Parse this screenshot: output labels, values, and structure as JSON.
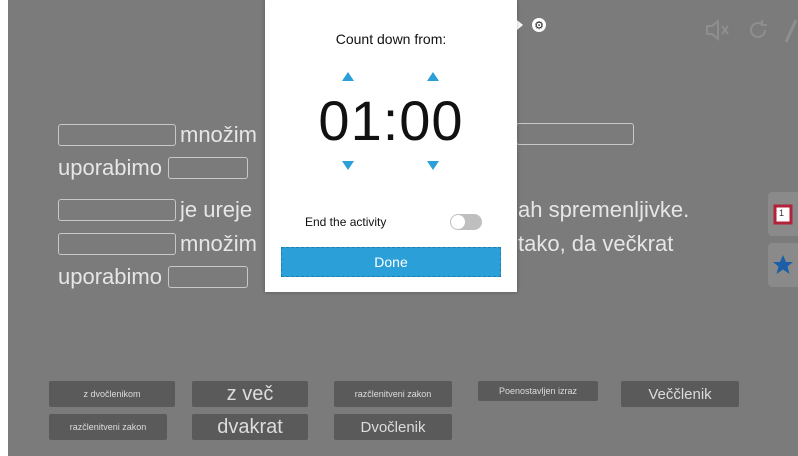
{
  "sentences": [
    {
      "text": "množim"
    },
    {
      "text": "uporabimo"
    },
    {
      "text": "je ureje",
      "tail": "ah spremenljivke."
    },
    {
      "text": "množim",
      "tail": "tako, da večkrat"
    },
    {
      "text": "uporabimo"
    }
  ],
  "chips": [
    {
      "label": "z dvočlenikom"
    },
    {
      "label": "z več"
    },
    {
      "label": "razčlenitveni zakon"
    },
    {
      "label": "Poenostavljen izraz"
    },
    {
      "label": "Veččlenik"
    },
    {
      "label": "razčlenitveni zakon"
    },
    {
      "label": "dvakrat"
    },
    {
      "label": "Dvočlenik"
    }
  ],
  "side_buttons": {
    "calendar_number": "1"
  },
  "modal": {
    "title": "Count down from:",
    "time": "01:00",
    "end_label": "End the activity",
    "toggle_on": false,
    "done_label": "Done"
  },
  "colors": {
    "accent": "#2a9fd8",
    "overlay": "#7b7b7b",
    "chip": "#5a5a5a"
  },
  "icons": [
    "gear-icon",
    "mute-icon",
    "reload-icon",
    "pen-icon",
    "calendar-icon",
    "star-icon"
  ]
}
